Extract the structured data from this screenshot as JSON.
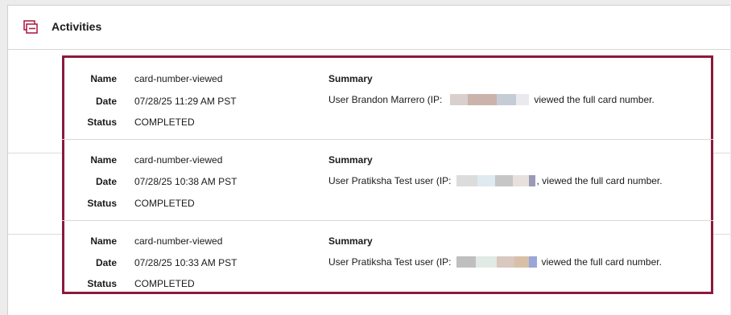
{
  "section": {
    "title": "Activities",
    "icon": "activities-icon",
    "accent": "#8b1a3c"
  },
  "labels": {
    "name": "Name",
    "date": "Date",
    "status": "Status",
    "summary": "Summary"
  },
  "activities": [
    {
      "name": "card-number-viewed",
      "date": "07/28/25 11:29 AM PST",
      "status": "COMPLETED",
      "summary_prefix": "User Brandon Marrero (IP:",
      "summary_suffix": "viewed the full card number.",
      "redaction_colors": [
        "#d9cfcc",
        "#cbb3ac",
        "#c6ccd6",
        "#e9e9ee"
      ]
    },
    {
      "name": "card-number-viewed",
      "date": "07/28/25 10:38 AM PST",
      "status": "COMPLETED",
      "summary_prefix": "User Pratiksha  Test user (IP:",
      "summary_suffix": ", viewed the full card number.",
      "redaction_colors": [
        "#dcdcdc",
        "#dfe9f0",
        "#c6c6c6",
        "#e8e0dc",
        "#9a9ab8"
      ]
    },
    {
      "name": "card-number-viewed",
      "date": "07/28/25 10:33 AM PST",
      "status": "COMPLETED",
      "summary_prefix": "User Pratiksha  Test user (IP:",
      "summary_suffix": "viewed the full card number.",
      "redaction_colors": [
        "#bfbfbf",
        "#e2eae6",
        "#d9c8bf",
        "#d8c0a8",
        "#9aa6d8"
      ]
    }
  ]
}
